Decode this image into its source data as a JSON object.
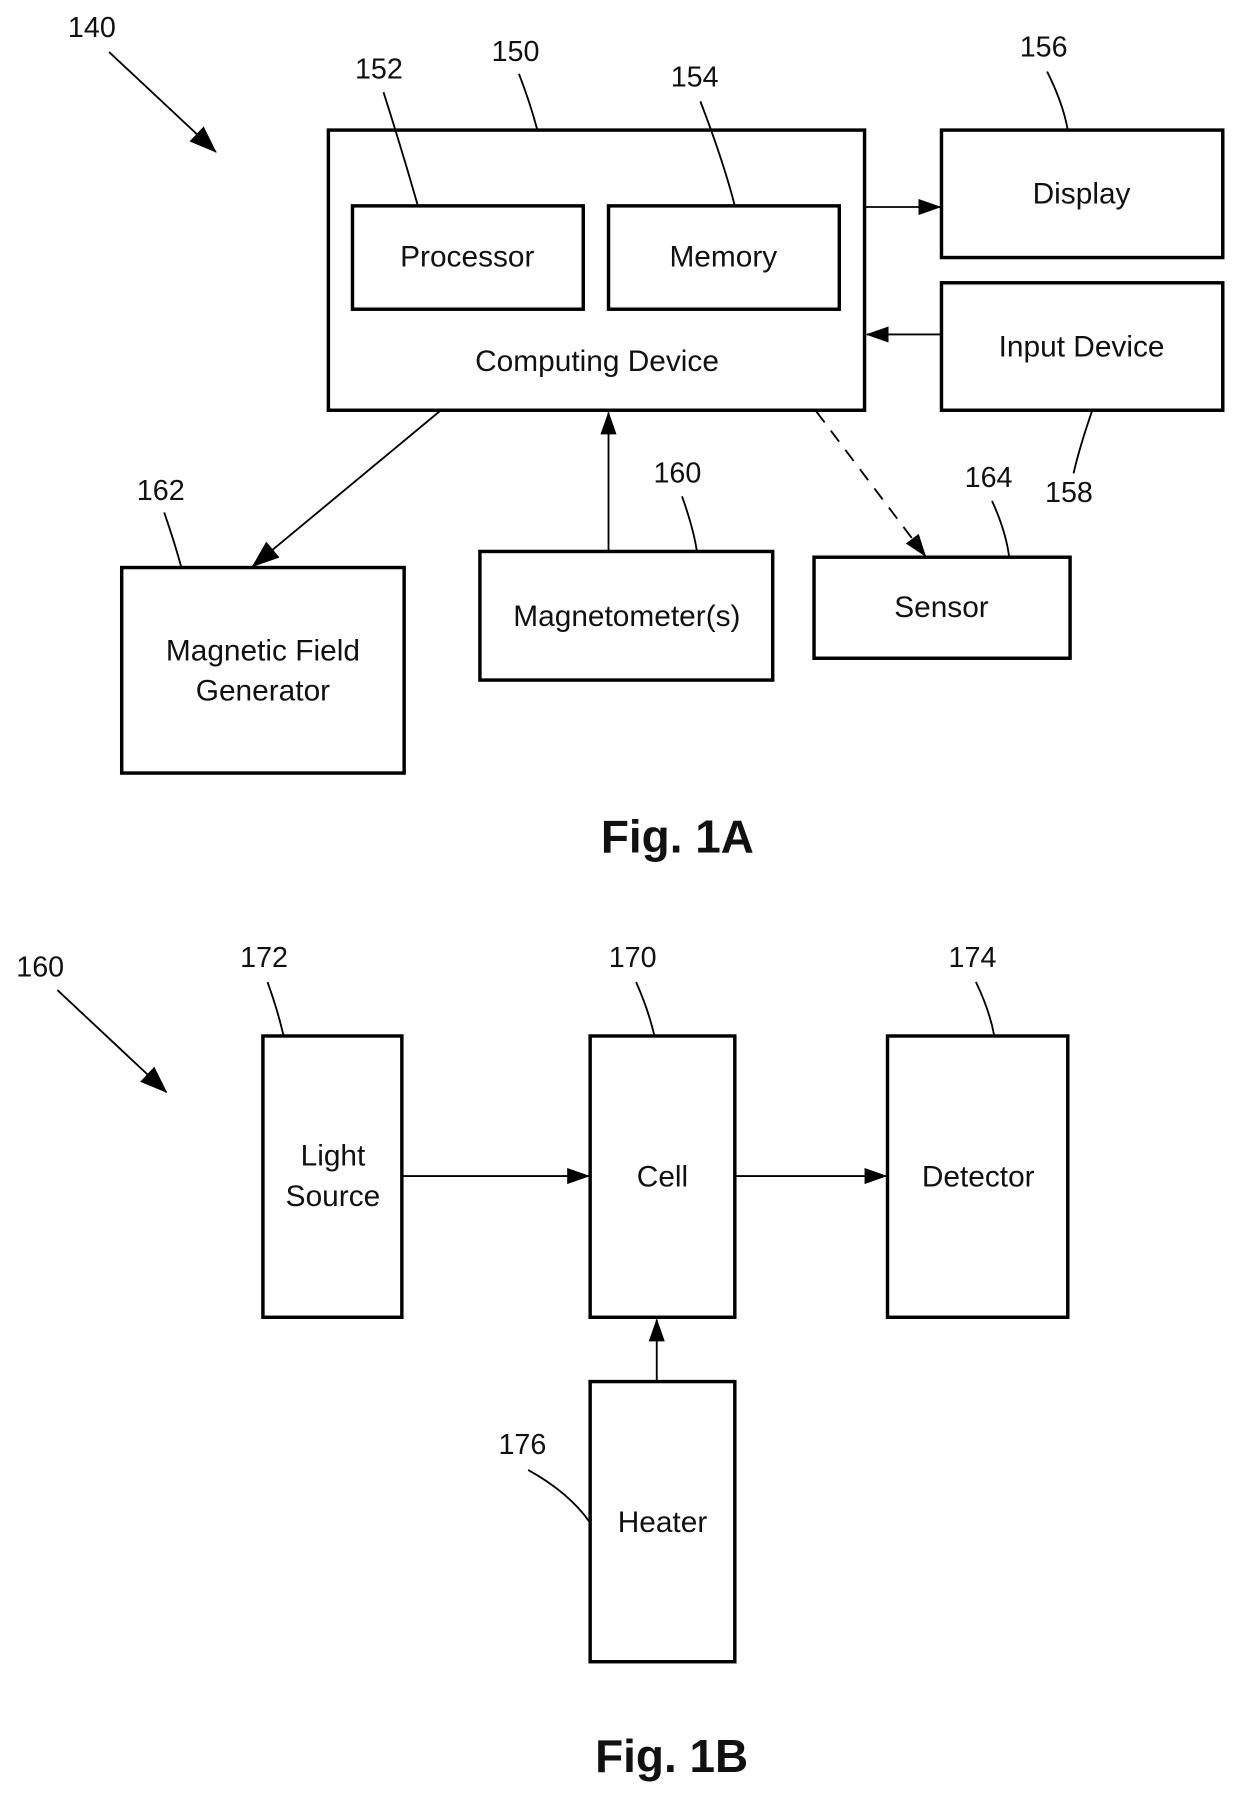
{
  "figures": [
    {
      "caption": "Fig. 1A",
      "system_ref": "140",
      "blocks": {
        "computing_device": {
          "ref": "150",
          "label": "Computing Device"
        },
        "processor": {
          "ref": "152",
          "label": "Processor"
        },
        "memory": {
          "ref": "154",
          "label": "Memory"
        },
        "display": {
          "ref": "156",
          "label": "Display"
        },
        "input_device": {
          "ref": "158",
          "label": "Input Device"
        },
        "magnetometers": {
          "ref": "160",
          "label": "Magnetometer(s)"
        },
        "magnetic_field_generator": {
          "ref": "162",
          "label_line1": "Magnetic Field",
          "label_line2": "Generator"
        },
        "sensor": {
          "ref": "164",
          "label": "Sensor"
        }
      },
      "connections": [
        {
          "from": "Computing Device",
          "to": "Display",
          "style": "solid"
        },
        {
          "from": "Input Device",
          "to": "Computing Device",
          "style": "solid"
        },
        {
          "from": "Computing Device",
          "to": "Magnetic Field Generator",
          "style": "solid"
        },
        {
          "from": "Magnetometer(s)",
          "to": "Computing Device",
          "style": "solid"
        },
        {
          "from": "Computing Device",
          "to": "Sensor",
          "style": "dashed"
        }
      ]
    },
    {
      "caption": "Fig. 1B",
      "system_ref": "160",
      "blocks": {
        "cell": {
          "ref": "170",
          "label": "Cell"
        },
        "light_source": {
          "ref": "172",
          "label_line1": "Light",
          "label_line2": "Source"
        },
        "detector": {
          "ref": "174",
          "label": "Detector"
        },
        "heater": {
          "ref": "176",
          "label": "Heater"
        }
      },
      "connections": [
        {
          "from": "Light Source",
          "to": "Cell",
          "style": "solid"
        },
        {
          "from": "Cell",
          "to": "Detector",
          "style": "solid"
        },
        {
          "from": "Heater",
          "to": "Cell",
          "style": "solid"
        }
      ]
    }
  ]
}
